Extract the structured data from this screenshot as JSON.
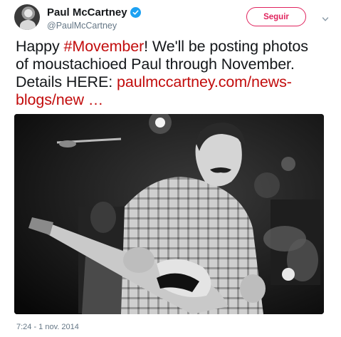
{
  "user": {
    "name": "Paul McCartney",
    "handle": "@PaulMcCartney",
    "verified": true
  },
  "follow_button": {
    "label": "Seguir"
  },
  "tweet": {
    "text_before_hashtag": "Happy ",
    "hashtag": "#Movember",
    "text_after_hashtag": "! We'll be posting photos of moustachioed Paul through November. Details HERE: ",
    "link": "paulmccartney.com/news-blogs/new …",
    "timestamp": "7:24 - 1 nov. 2014"
  },
  "colors": {
    "accent": "#c20c0c",
    "follow": "#e0245e",
    "verified": "#1da1f2",
    "muted": "#657786"
  },
  "icons": [
    "verified-badge-icon",
    "chevron-down-icon"
  ]
}
